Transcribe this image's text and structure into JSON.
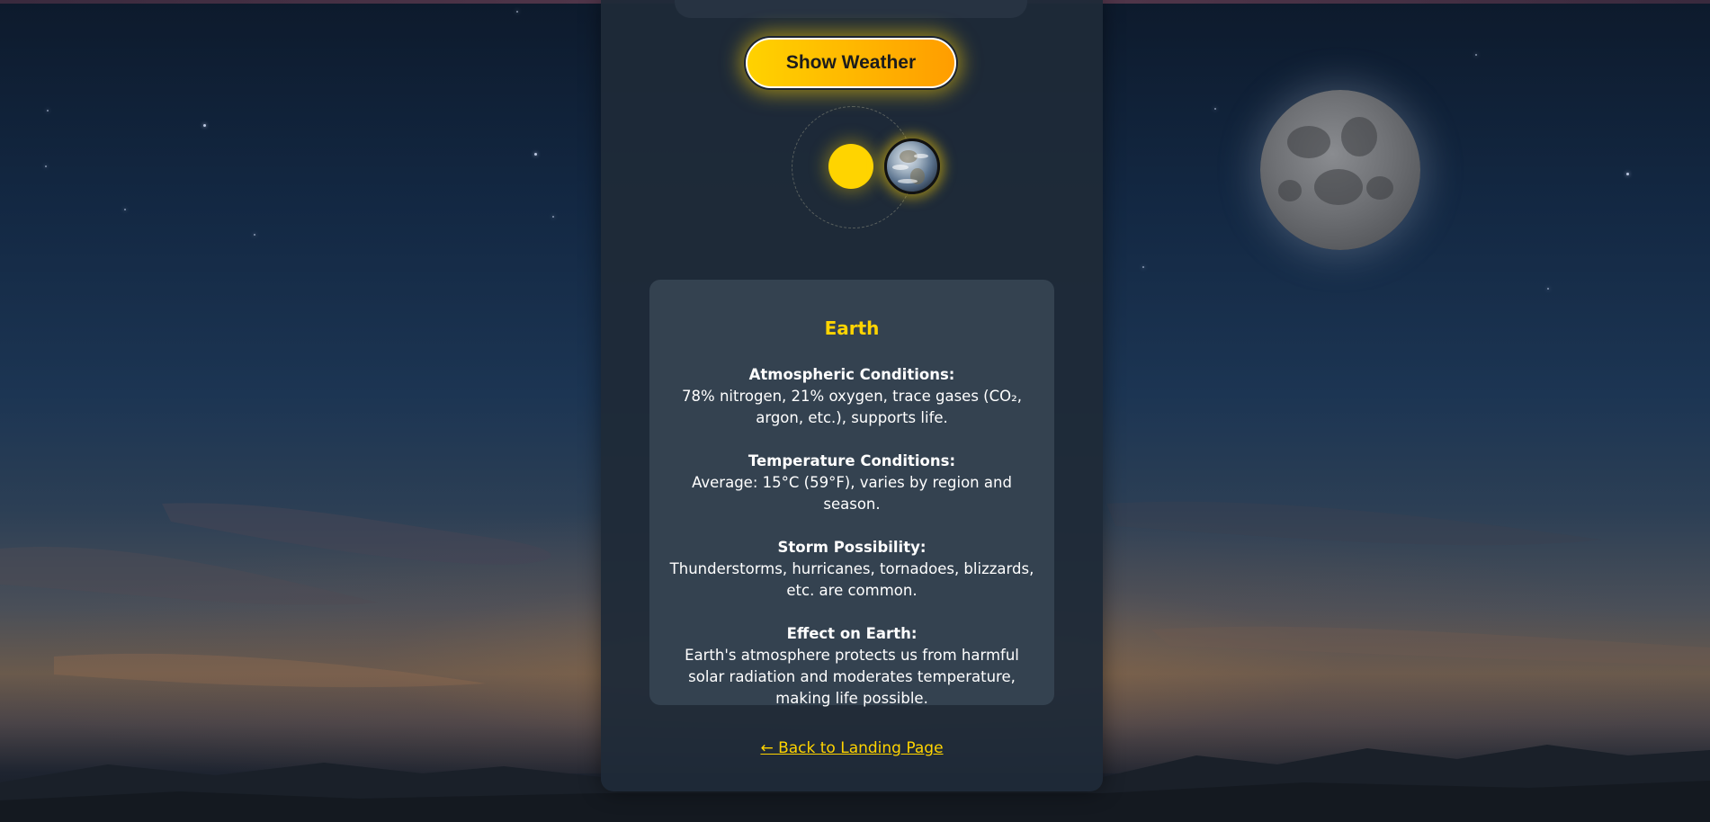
{
  "controls": {
    "show_weather_label": "Show Weather"
  },
  "planet": {
    "name": "Earth",
    "sections": [
      {
        "label": "Atmospheric Conditions:",
        "text": "78% nitrogen, 21% oxygen, trace gases (CO₂, argon, etc.), supports life."
      },
      {
        "label": "Temperature Conditions:",
        "text": "Average: 15°C (59°F), varies by region and season."
      },
      {
        "label": "Storm Possibility:",
        "text": "Thunderstorms, hurricanes, tornadoes, blizzards, etc. are common."
      },
      {
        "label": "Effect on Earth:",
        "text": "Earth's atmosphere protects us from harmful solar radiation and moderates temperature, making life possible."
      }
    ]
  },
  "nav": {
    "back_label": "← Back to Landing Page"
  },
  "colors": {
    "accent": "#ffd400",
    "button_gradient_end": "#ff9d00",
    "panel": "#1f2a38",
    "card": "#344250"
  },
  "icons": {
    "sun": "sun-icon",
    "earth": "earth-icon",
    "moon": "moon-icon"
  }
}
